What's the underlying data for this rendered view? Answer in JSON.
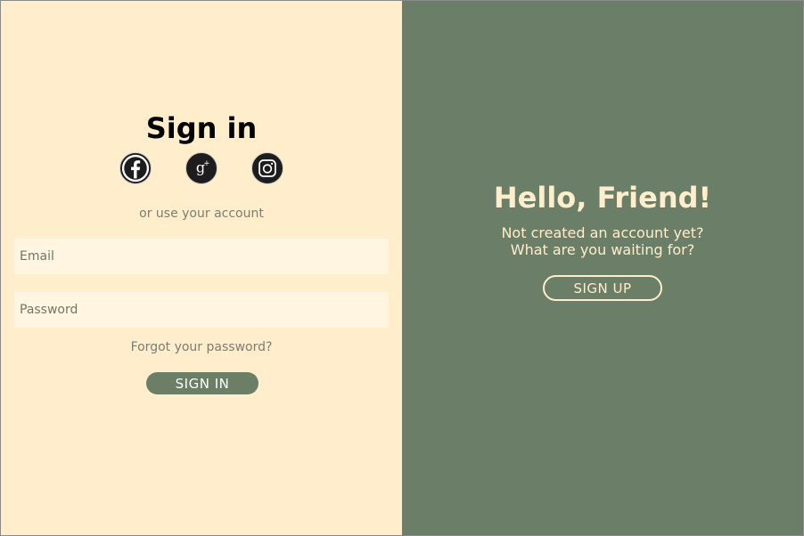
{
  "signin": {
    "title": "Sign in",
    "social_icons": [
      "facebook-icon",
      "google-plus-icon",
      "instagram-icon"
    ],
    "alt_text": "or use your account",
    "email_placeholder": "Email",
    "password_placeholder": "Password",
    "forgot_text": "Forgot your password?",
    "button_label": "SIGN IN"
  },
  "signup": {
    "title": "Hello, Friend!",
    "subtitle_line1": "Not created an account yet?",
    "subtitle_line2": "What are you waiting for?",
    "button_label": "SIGN UP"
  },
  "colors": {
    "left_background": "#ffedcb",
    "right_background": "#6b7f68",
    "input_background": "#fff5e1",
    "accent": "#6a7f66",
    "light_text": "#ffedcb"
  }
}
